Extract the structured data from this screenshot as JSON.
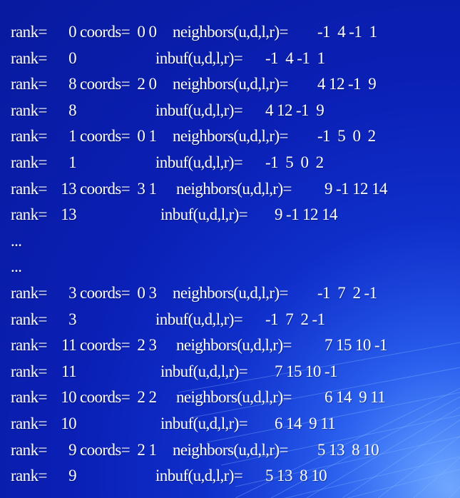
{
  "lines": [
    {
      "kind": "coords",
      "rank_label": "rank=",
      "rank": "0",
      "coords": "coords=  0 0",
      "neighbors_label": "neighbors(u,d,l,r)=",
      "values": "-1  4 -1  1"
    },
    {
      "kind": "inbuf",
      "rank_label": "rank=",
      "rank": "0",
      "inbuf_label": "inbuf(u,d,l,r)=",
      "values": "-1  4 -1  1"
    },
    {
      "kind": "coords",
      "rank_label": "rank=",
      "rank": "8",
      "coords": "coords=  2 0",
      "neighbors_label": "neighbors(u,d,l,r)=",
      "values": "4 12 -1  9"
    },
    {
      "kind": "inbuf",
      "rank_label": "rank=",
      "rank": "8",
      "inbuf_label": "inbuf(u,d,l,r)=",
      "values": "4 12 -1  9"
    },
    {
      "kind": "coords",
      "rank_label": "rank=",
      "rank": "1",
      "coords": "coords=  0 1",
      "neighbors_label": "neighbors(u,d,l,r)=",
      "values": "-1  5  0  2"
    },
    {
      "kind": "inbuf",
      "rank_label": "rank=",
      "rank": "1",
      "inbuf_label": "inbuf(u,d,l,r)=",
      "values": "-1  5  0  2"
    },
    {
      "kind": "coords",
      "rank_label": "rank=",
      "rank": "13",
      "coords": "coords=  3 1",
      "neighbors_label": "neighbors(u,d,l,r)=",
      "values": "9 -1 12 14"
    },
    {
      "kind": "inbuf",
      "rank_label": "rank=",
      "rank": "13",
      "inbuf_label": "inbuf(u,d,l,r)=",
      "values": "9 -1 12 14"
    },
    {
      "kind": "dots",
      "text": "..."
    },
    {
      "kind": "dots",
      "text": "..."
    },
    {
      "kind": "coords",
      "rank_label": "rank=",
      "rank": "3",
      "coords": "coords=  0 3",
      "neighbors_label": "neighbors(u,d,l,r)=",
      "values": "-1  7  2 -1"
    },
    {
      "kind": "inbuf",
      "rank_label": "rank=",
      "rank": "3",
      "inbuf_label": "inbuf(u,d,l,r)=",
      "values": "-1  7  2 -1"
    },
    {
      "kind": "coords",
      "rank_label": "rank=",
      "rank": "11",
      "coords": "coords=  2 3",
      "neighbors_label": "neighbors(u,d,l,r)=",
      "values": "7 15 10 -1"
    },
    {
      "kind": "inbuf",
      "rank_label": "rank=",
      "rank": "11",
      "inbuf_label": "inbuf(u,d,l,r)=",
      "values": "7 15 10 -1"
    },
    {
      "kind": "coords",
      "rank_label": "rank=",
      "rank": "10",
      "coords": "coords=  2 2",
      "neighbors_label": "neighbors(u,d,l,r)=",
      "values": "6 14  9 11"
    },
    {
      "kind": "inbuf",
      "rank_label": "rank=",
      "rank": "10",
      "inbuf_label": "inbuf(u,d,l,r)=",
      "values": "6 14  9 11"
    },
    {
      "kind": "coords",
      "rank_label": "rank=",
      "rank": "9",
      "coords": "coords=  2 1",
      "neighbors_label": "neighbors(u,d,l,r)=",
      "values": "5 13  8 10"
    },
    {
      "kind": "inbuf",
      "rank_label": "rank=",
      "rank": "9",
      "inbuf_label": "inbuf(u,d,l,r)=",
      "values": "5 13  8 10"
    }
  ],
  "colors": {
    "background": "#0a1fb4",
    "text": "#ffffff",
    "grid": "#6fa6ff"
  }
}
